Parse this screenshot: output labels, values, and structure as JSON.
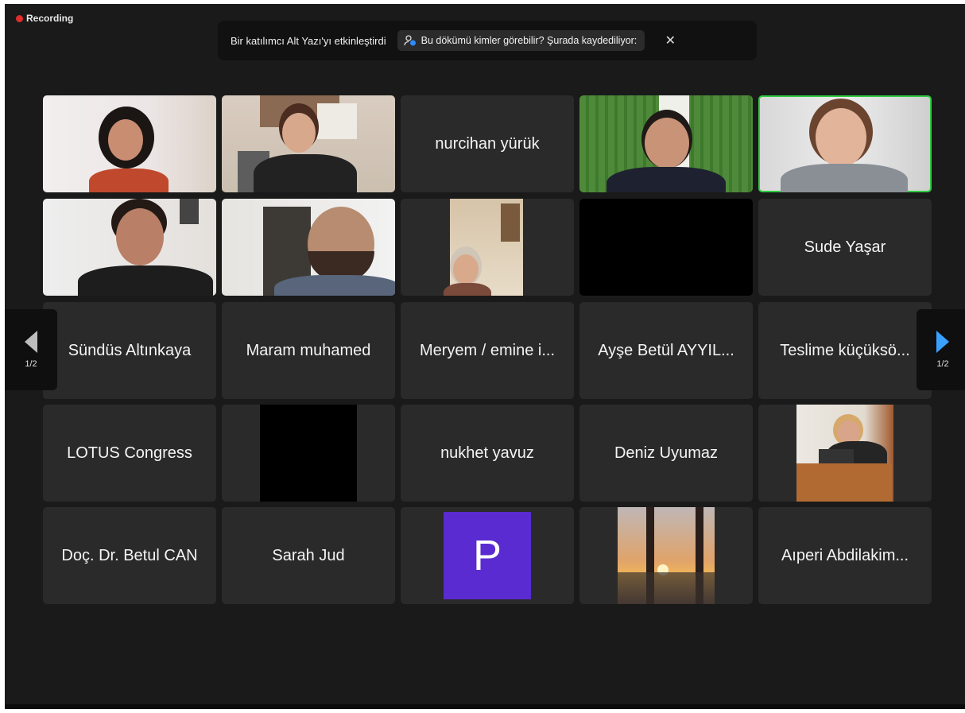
{
  "recording": {
    "label": "Recording"
  },
  "notice": {
    "text": "Bir katılımcı Alt Yazı'yı etkinleştirdi",
    "chip_label": "Bu dökümü kimler görebilir? Şurada kaydediliyor:",
    "close_glyph": "✕",
    "chip_icon": "person-info-icon"
  },
  "pagination": {
    "left": "1/2",
    "right": "1/2"
  },
  "colors": {
    "speaking_border": "#2ecc40",
    "next_arrow": "#3aa0ff",
    "record_dot": "#e02d2d"
  },
  "tiles": [
    {
      "type": "video",
      "label": ""
    },
    {
      "type": "video",
      "label": ""
    },
    {
      "type": "name",
      "label": "nurcihan yürük"
    },
    {
      "type": "video",
      "label": ""
    },
    {
      "type": "video",
      "label": "",
      "speaking": true
    },
    {
      "type": "video",
      "label": ""
    },
    {
      "type": "video",
      "label": ""
    },
    {
      "type": "video",
      "label": ""
    },
    {
      "type": "blank",
      "label": ""
    },
    {
      "type": "name",
      "label": "Sude Yaşar"
    },
    {
      "type": "name",
      "label": "Sündüs Altınkaya"
    },
    {
      "type": "name",
      "label": "Maram muhamed"
    },
    {
      "type": "name",
      "label": "Meryem / emine i..."
    },
    {
      "type": "name",
      "label": "Ayşe Betül AYYIL..."
    },
    {
      "type": "name",
      "label": "Teslime küçüksö..."
    },
    {
      "type": "name",
      "label": "LOTUS Congress"
    },
    {
      "type": "blank",
      "label": ""
    },
    {
      "type": "name",
      "label": "nukhet yavuz"
    },
    {
      "type": "name",
      "label": "Deniz Uyumaz"
    },
    {
      "type": "video",
      "label": ""
    },
    {
      "type": "name",
      "label": "Doç. Dr. Betul CAN"
    },
    {
      "type": "name",
      "label": "Sarah Jud"
    },
    {
      "type": "avatar",
      "label": "P"
    },
    {
      "type": "video",
      "label": ""
    },
    {
      "type": "name",
      "label": "Aıperi Abdilakim..."
    }
  ]
}
